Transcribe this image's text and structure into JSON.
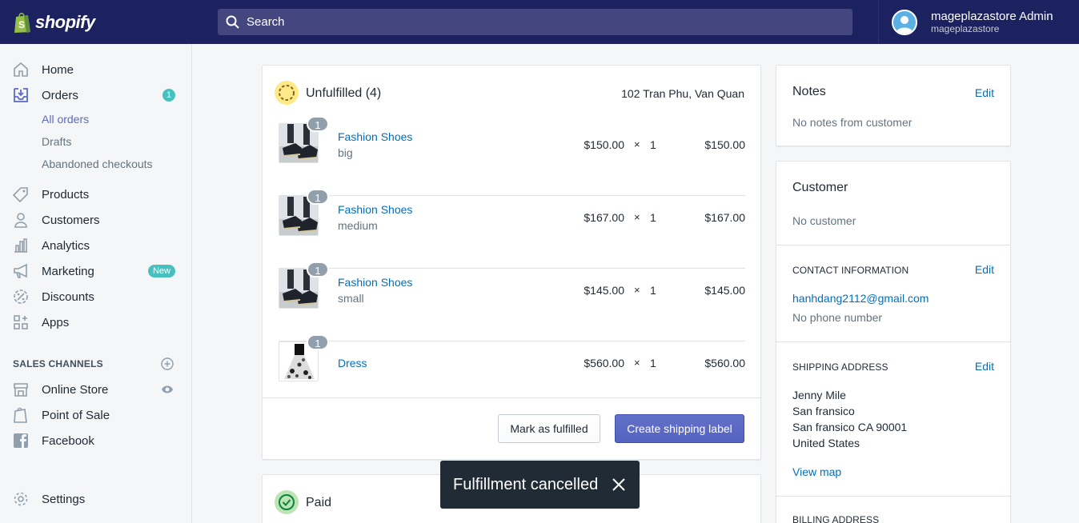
{
  "brand": {
    "name": "shopify"
  },
  "search": {
    "placeholder": "Search"
  },
  "account": {
    "name": "mageplazastore Admin",
    "store": "mageplazastore"
  },
  "sidebar": {
    "home": "Home",
    "orders": "Orders",
    "orders_badge": "1",
    "orders_sub": [
      "All orders",
      "Drafts",
      "Abandoned checkouts"
    ],
    "products": "Products",
    "customers": "Customers",
    "analytics": "Analytics",
    "marketing": "Marketing",
    "marketing_badge": "New",
    "discounts": "Discounts",
    "apps": "Apps",
    "sales_channels": "SALES CHANNELS",
    "online_store": "Online Store",
    "pos": "Point of Sale",
    "facebook": "Facebook",
    "settings": "Settings"
  },
  "unfulfilled": {
    "title": "Unfulfilled (4)",
    "location": "102 Tran Phu, Van Quan",
    "items": [
      {
        "qty_badge": "1",
        "name": "Fashion Shoes",
        "variant": "big",
        "price": "$150.00",
        "times": "×",
        "qty": "1",
        "total": "$150.00"
      },
      {
        "qty_badge": "1",
        "name": "Fashion Shoes",
        "variant": "medium",
        "price": "$167.00",
        "times": "×",
        "qty": "1",
        "total": "$167.00"
      },
      {
        "qty_badge": "1",
        "name": "Fashion Shoes",
        "variant": "small",
        "price": "$145.00",
        "times": "×",
        "qty": "1",
        "total": "$145.00"
      },
      {
        "qty_badge": "1",
        "name": "Dress",
        "variant": "",
        "price": "$560.00",
        "times": "×",
        "qty": "1",
        "total": "$560.00"
      }
    ],
    "mark_fulfilled": "Mark as fulfilled",
    "create_label": "Create shipping label"
  },
  "paid": {
    "title": "Paid"
  },
  "notes": {
    "title": "Notes",
    "edit": "Edit",
    "text": "No notes from customer"
  },
  "customer": {
    "title": "Customer",
    "text": "No customer",
    "contact_heading": "CONTACT INFORMATION",
    "contact_edit": "Edit",
    "email": "hanhdang2112@gmail.com",
    "phone": "No phone number",
    "shipping_heading": "SHIPPING ADDRESS",
    "shipping_edit": "Edit",
    "address": [
      "Jenny Mile",
      "San fransico",
      "San fransico CA 90001",
      "United States"
    ],
    "view_map": "View map",
    "billing_heading": "BILLING ADDRESS"
  },
  "toast": {
    "message": "Fulfillment cancelled"
  },
  "colors": {
    "nav_bg": "#1c2260",
    "accent": "#5c6ac4",
    "link": "#006fbb",
    "badge": "#47c1bf"
  }
}
